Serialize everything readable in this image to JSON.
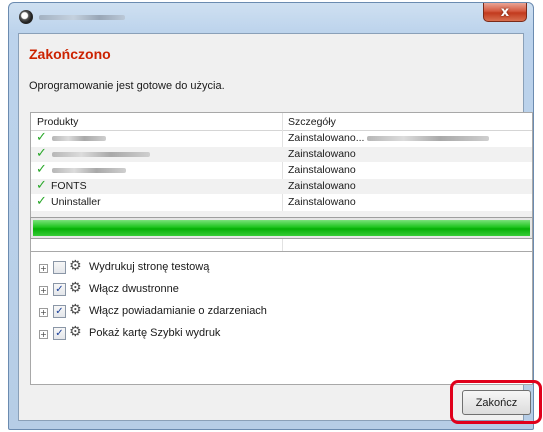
{
  "window": {
    "close_glyph": "x",
    "app_icon": "installer-disc-icon"
  },
  "header": {
    "title": "Zakończono",
    "message": "Oprogramowanie jest gotowe do użycia."
  },
  "products": {
    "columns": [
      "Produkty",
      "Szczegóły"
    ],
    "rows": [
      {
        "name": "",
        "status": "Zainstalowano...",
        "installed": true
      },
      {
        "name": "",
        "status": "Zainstalowano",
        "installed": true
      },
      {
        "name": "",
        "status": "Zainstalowano",
        "installed": true
      },
      {
        "name": "FONTS",
        "status": "Zainstalowano",
        "installed": true
      },
      {
        "name": "Uninstaller",
        "status": "Zainstalowano",
        "installed": true
      }
    ],
    "check_glyph": "✓"
  },
  "progress": {
    "percent": 100,
    "color": "#1fc41f"
  },
  "options": [
    {
      "label": "Wydrukuj stronę testową",
      "checked": false,
      "expander": "+",
      "icon": "gear-icon"
    },
    {
      "label": "Włącz dwustronne",
      "checked": true,
      "expander": "+",
      "icon": "gear-icon"
    },
    {
      "label": "Włącz powiadamianie o zdarzeniach",
      "checked": true,
      "expander": "+",
      "icon": "gear-icon"
    },
    {
      "label": "Pokaż kartę Szybki wydruk",
      "checked": true,
      "expander": "+",
      "icon": "gear-icon"
    }
  ],
  "footer": {
    "finish_label": "Zakończ",
    "highlight_color": "#e0001b"
  }
}
